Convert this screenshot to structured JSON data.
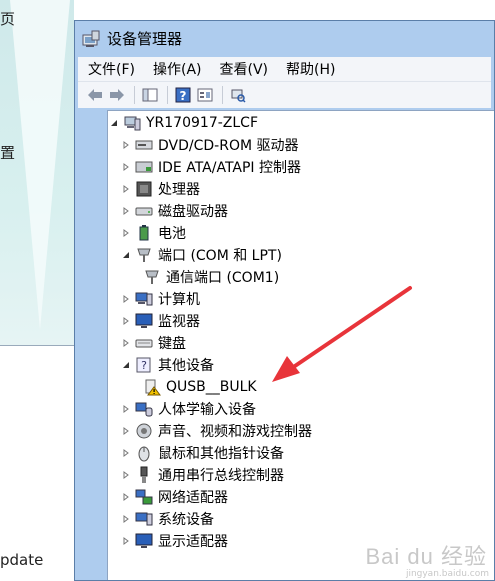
{
  "background": {
    "frag_top": "页",
    "frag_mid": "置",
    "frag_bottom": "pdate"
  },
  "window": {
    "title": "设备管理器",
    "menus": [
      "文件(F)",
      "操作(A)",
      "查看(V)",
      "帮助(H)"
    ]
  },
  "tree": {
    "root": "YR170917-ZLCF",
    "items": [
      "DVD/CD-ROM 驱动器",
      "IDE ATA/ATAPI 控制器",
      "处理器",
      "磁盘驱动器",
      "电池",
      "端口 (COM 和 LPT)",
      "通信端口 (COM1)",
      "计算机",
      "监视器",
      "键盘",
      "其他设备",
      "QUSB__BULK",
      "人体学输入设备",
      "声音、视频和游戏控制器",
      "鼠标和其他指针设备",
      "通用串行总线控制器",
      "网络适配器",
      "系统设备",
      "显示适配器"
    ]
  },
  "watermark": {
    "text": "Bai du 经验",
    "sub": "jingyan.baidu.com"
  },
  "colors": {
    "arrow": "#e8343a",
    "title_bar": "#aeccee"
  }
}
